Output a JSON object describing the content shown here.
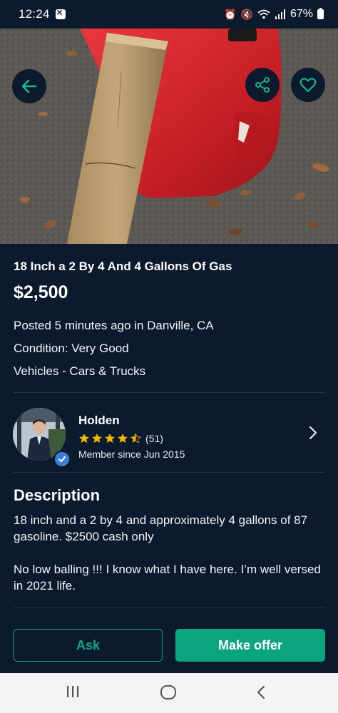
{
  "status_bar": {
    "time": "12:24",
    "battery_percent": "67%"
  },
  "listing": {
    "title": "18 Inch a 2 By 4 And 4 Gallons Of Gas",
    "price": "$2,500",
    "posted": "Posted 5 minutes ago in Danville, CA",
    "condition": "Condition: Very Good",
    "category": "Vehicles - Cars & Trucks"
  },
  "seller": {
    "name": "Holden",
    "rating": 4.5,
    "rating_count": "(51)",
    "member_since": "Member since Jun 2015"
  },
  "description": {
    "heading": "Description",
    "paragraph_1": "18 inch and a 2 by 4 and approximately 4 gallons of 87 gasoline. $2500 cash only",
    "paragraph_2": "No low balling !!! I know what I have here. I’m well versed in 2021 life."
  },
  "actions": {
    "ask_label": "Ask",
    "offer_label": "Make offer"
  },
  "icons": {
    "back": "arrow-left-icon",
    "share": "share-icon",
    "favorite": "heart-icon",
    "chevron": "chevron-right-icon",
    "verified": "check-badge-icon"
  },
  "colors": {
    "background": "#0c1a2e",
    "accent": "#0aa57d",
    "star": "#f5b800"
  }
}
